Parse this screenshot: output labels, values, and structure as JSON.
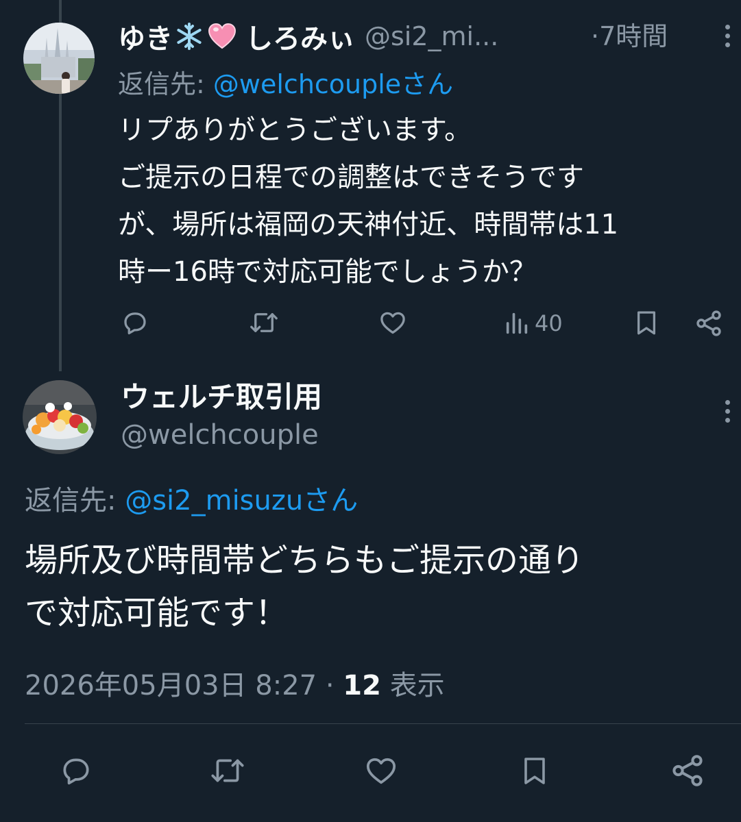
{
  "tweet1": {
    "display_name": "ゆき",
    "display_name_suffix": "しろみぃ",
    "emoji": [
      "snowflake",
      "pink-heart"
    ],
    "handle": "@si2_mi...",
    "time": "·7時間",
    "reply_label": "返信先:",
    "reply_to": "@welchcoupleさん",
    "text": "リプありがとうございます。\nご提示の日程での調整はできそうです\nが、場所は福岡の天神付近、時間帯は11\n時ー16時で対応可能でしょうか？",
    "actions": {
      "reply_icon": "reply-icon",
      "retweet_icon": "retweet-icon",
      "like_icon": "like-icon",
      "views_icon": "views-icon",
      "views_count": "40",
      "bookmark_icon": "bookmark-icon",
      "share_icon": "share-icon"
    }
  },
  "tweet2": {
    "display_name": "ウェルチ取引用",
    "handle": "@welchcouple",
    "reply_label": "返信先:",
    "reply_to": "@si2_misuzuさん",
    "text": "場所及び時間帯どちらもご提示の通り\nで対応可能です！",
    "timestamp": "2026年05月03日 8:27",
    "separator": "·",
    "views_num": "12",
    "views_label": "表示"
  },
  "colors": {
    "background": "#15202b",
    "text": "#f7f9f9",
    "muted": "#8b98a5",
    "link": "#1d9bf0",
    "line": "#38444d"
  }
}
